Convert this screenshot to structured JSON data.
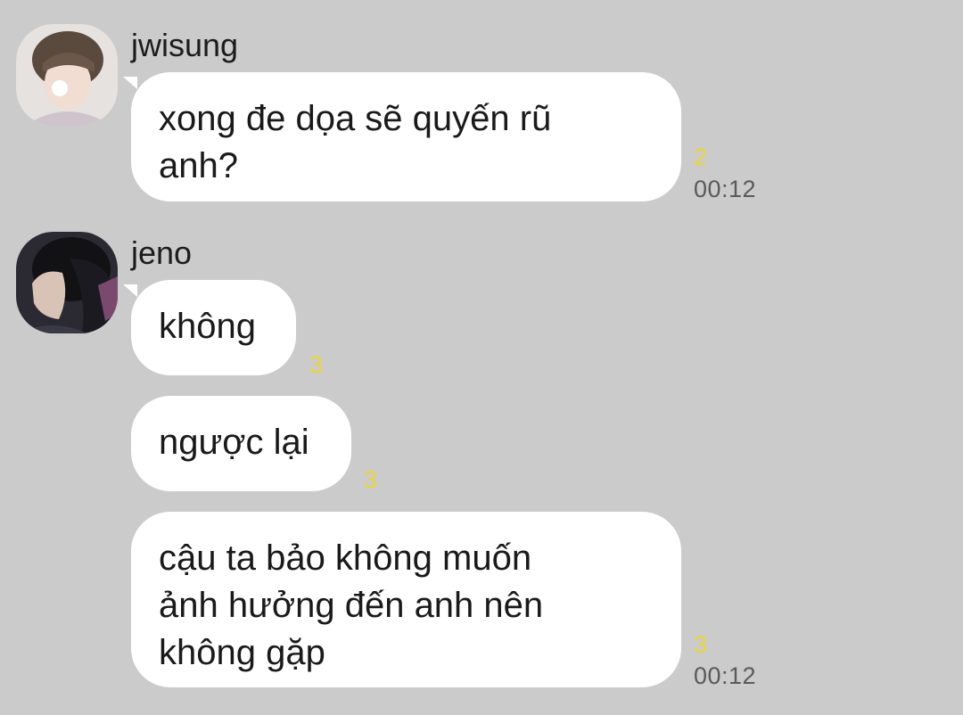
{
  "groups": [
    {
      "sender": "jwisung",
      "messages": [
        {
          "text": "xong đe dọa sẽ quyến rũ\nanh?",
          "read_count": "2",
          "time": "00:12"
        }
      ]
    },
    {
      "sender": "jeno",
      "messages": [
        {
          "text": "không",
          "read_count": "3",
          "time": ""
        },
        {
          "text": "ngược lại",
          "read_count": "3",
          "time": ""
        },
        {
          "text": "cậu ta bảo không muốn\nảnh hưởng đến anh nên\nkhông gặp",
          "read_count": "3",
          "time": "00:12"
        }
      ]
    }
  ],
  "colors": {
    "background": "#cbcbcb",
    "bubble": "#ffffff",
    "read_count": "#e9d53a",
    "timestamp": "#5a5a5a"
  }
}
